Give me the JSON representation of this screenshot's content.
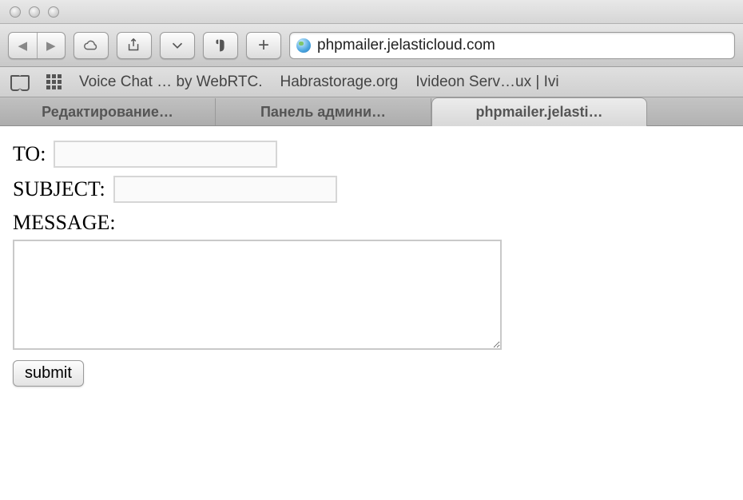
{
  "address_bar": {
    "url": "phpmailer.jelasticloud.com"
  },
  "bookmarks": {
    "items": [
      "Voice Chat … by WebRTC.",
      "Habrastorage.org",
      "Ivideon Serv…ux | Ivi"
    ]
  },
  "tabs": {
    "items": [
      {
        "label": "Редактирование…"
      },
      {
        "label": "Панель админи…"
      },
      {
        "label": "phpmailer.jelasti…"
      }
    ]
  },
  "form": {
    "to_label": "TO:",
    "to_value": "",
    "subject_label": "SUBJECT:",
    "subject_value": "",
    "message_label": "MESSAGE:",
    "message_value": "",
    "submit_label": "submit"
  }
}
